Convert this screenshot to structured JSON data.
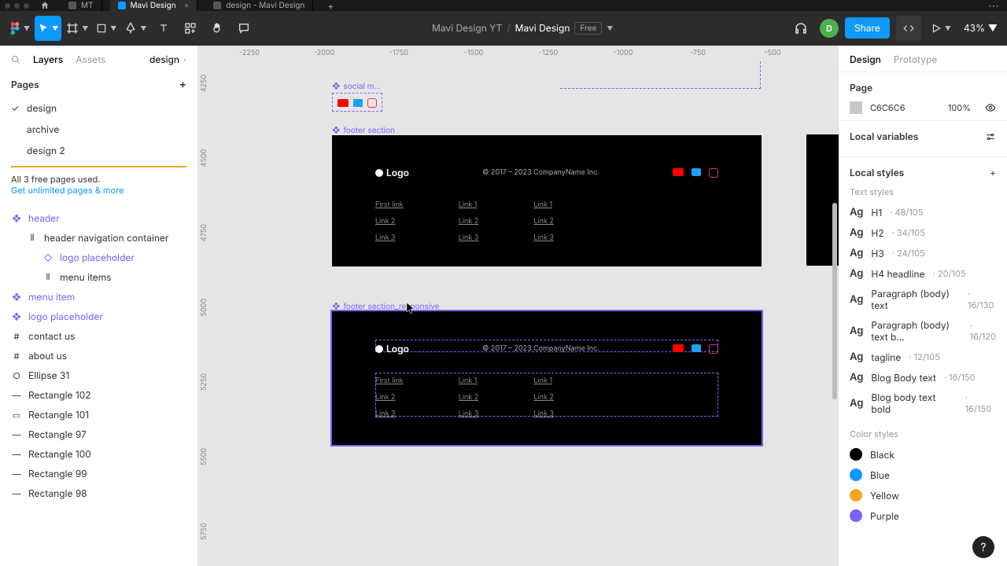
{
  "tabs": {
    "items": [
      {
        "label": "MT",
        "active": false
      },
      {
        "label": "Mavi Design",
        "active": true
      },
      {
        "label": "design - Mavi Design",
        "active": false
      }
    ]
  },
  "toolbar": {
    "project": "Mavi Design YT",
    "filename": "Mavi Design",
    "plan_badge": "Free",
    "share": "Share",
    "avatar_letter": "D",
    "zoom": "43%"
  },
  "leftpanel": {
    "tabs": {
      "layers": "Layers",
      "assets": "Assets",
      "page_select": "design"
    },
    "pages_header": "Pages",
    "pages": [
      {
        "label": "design",
        "checked": true
      },
      {
        "label": "archive",
        "checked": false
      },
      {
        "label": "design 2",
        "checked": false
      }
    ],
    "warn_line1": "All 3 free pages used.",
    "warn_link": "Get unlimited pages & more",
    "layers": [
      {
        "label": "header",
        "type": "component",
        "indent": 0
      },
      {
        "label": "header navigation container",
        "type": "autolayout",
        "indent": 1
      },
      {
        "label": "logo placeholder",
        "type": "instance",
        "indent": 2
      },
      {
        "label": "menu items",
        "type": "autolayout",
        "indent": 2
      },
      {
        "label": "menu item",
        "type": "component",
        "indent": 0
      },
      {
        "label": "logo placeholder",
        "type": "component",
        "indent": 0
      },
      {
        "label": "contact us",
        "type": "frame",
        "indent": 0
      },
      {
        "label": "about us",
        "type": "frame",
        "indent": 0
      },
      {
        "label": "Ellipse 31",
        "type": "ellipse",
        "indent": 0
      },
      {
        "label": "Rectangle 102",
        "type": "line",
        "indent": 0
      },
      {
        "label": "Rectangle 101",
        "type": "rect",
        "indent": 0
      },
      {
        "label": "Rectangle 97",
        "type": "line",
        "indent": 0
      },
      {
        "label": "Rectangle 100",
        "type": "line",
        "indent": 0
      },
      {
        "label": "Rectangle 99",
        "type": "line",
        "indent": 0
      },
      {
        "label": "Rectangle 98",
        "type": "line",
        "indent": 0
      }
    ]
  },
  "canvas": {
    "ruler_h": [
      "-2250",
      "-2000",
      "-1750",
      "-1500",
      "-1250",
      "-1000",
      "-750",
      "-500"
    ],
    "ruler_v": [
      "4250",
      "4500",
      "4750",
      "5000",
      "5250",
      "5500",
      "5750"
    ],
    "labels": {
      "social": "social m...",
      "footer": "footer section",
      "footer_resp": "footer section_responsive"
    },
    "footer": {
      "logo": "Logo",
      "copyright": "© 2017 – 2023 CompanyName Inc.",
      "link_cols": [
        [
          "First link",
          "Link 2",
          "Link 3"
        ],
        [
          "Link 1",
          "Link 2",
          "Link 3"
        ],
        [
          "Link 1",
          "Link 2",
          "Link 3"
        ]
      ]
    }
  },
  "rightpanel": {
    "tabs": {
      "design": "Design",
      "prototype": "Prototype"
    },
    "page_header": "Page",
    "page_color": "C6C6C6",
    "page_opacity": "100%",
    "local_variables": "Local variables",
    "local_styles": "Local styles",
    "text_styles_header": "Text styles",
    "text_styles": [
      {
        "name": "H1",
        "meta": "48/105"
      },
      {
        "name": "H2",
        "meta": "34/105"
      },
      {
        "name": "H3",
        "meta": "24/105"
      },
      {
        "name": "H4 headline",
        "meta": "20/105"
      },
      {
        "name": "Paragraph (body) text",
        "meta": "16/130"
      },
      {
        "name": "Paragraph (body) text b...",
        "meta": "16/120"
      },
      {
        "name": "tagline",
        "meta": "12/105"
      },
      {
        "name": "Blog Body text",
        "meta": "16/150"
      },
      {
        "name": "Blog body text bold",
        "meta": "16/150"
      }
    ],
    "color_styles_header": "Color styles",
    "color_styles": [
      {
        "name": "Black",
        "hex": "#000000"
      },
      {
        "name": "Blue",
        "hex": "#0d99ff"
      },
      {
        "name": "Yellow",
        "hex": "#f5a623"
      },
      {
        "name": "Purple",
        "hex": "#7b61ff"
      }
    ]
  }
}
